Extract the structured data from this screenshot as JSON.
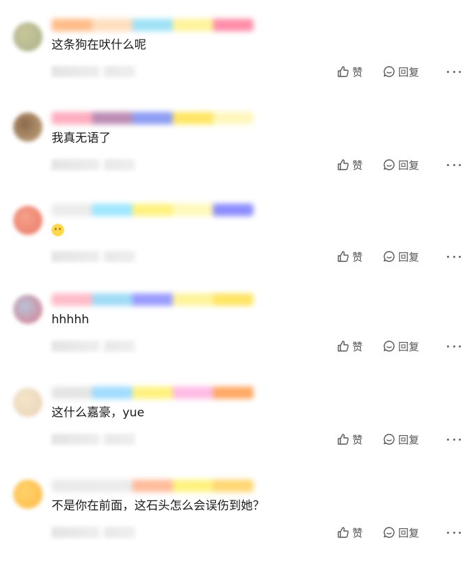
{
  "comments": [
    {
      "text": "这条狗在吠什么呢",
      "like_label": "赞",
      "reply_label": "回复",
      "avatar_colors": [
        "#c9c79a",
        "#a8b08a"
      ],
      "name_colors": [
        "#ffb074",
        "#ffd9b3",
        "#8fdcf5",
        "#fff28a",
        "#ff7a9a"
      ]
    },
    {
      "text": "我真无语了",
      "like_label": "赞",
      "reply_label": "回复",
      "avatar_colors": [
        "#8a6a4a",
        "#c8a882"
      ],
      "name_colors": [
        "#ff9fb5",
        "#b07aa8",
        "#7a8cf2",
        "#ffe24a",
        "#fff5b0"
      ]
    },
    {
      "text": "",
      "emoji": "smile-emoji",
      "like_label": "赞",
      "reply_label": "回复",
      "avatar_colors": [
        "#f6a08a",
        "#e87a6a"
      ],
      "name_colors": [
        "#e8e8e8",
        "#8fe3ff",
        "#fff06a",
        "#fff8b0",
        "#7a7aff"
      ]
    },
    {
      "text": "hhhhh",
      "like_label": "赞",
      "reply_label": "回复",
      "avatar_colors": [
        "#b8c4d8",
        "#d87a8a"
      ],
      "name_colors": [
        "#ffb0c0",
        "#8fd6f5",
        "#8a8aff",
        "#fff28a",
        "#ffe04a"
      ]
    },
    {
      "text": "这什么嘉豪，yue",
      "like_label": "赞",
      "reply_label": "回复",
      "avatar_colors": [
        "#f4e6c8",
        "#e8d0b8"
      ],
      "name_colors": [
        "#e0e0e0",
        "#8fd6ff",
        "#fff06a",
        "#ffb0e0",
        "#ff9a4a"
      ]
    },
    {
      "text": "不是你在前面，这石头怎么会误伤到她？",
      "like_label": "赞",
      "reply_label": "回复",
      "avatar_colors": [
        "#ffd36a",
        "#ffb84a"
      ],
      "name_colors": [
        "#e6e6e6",
        "#e8e8e8",
        "#ffb08a",
        "#fff06a",
        "#ffd05a"
      ]
    }
  ],
  "icons": {
    "like": "thumbs-up-icon",
    "reply": "reply-bubble-icon",
    "more": "more-dots-icon"
  }
}
